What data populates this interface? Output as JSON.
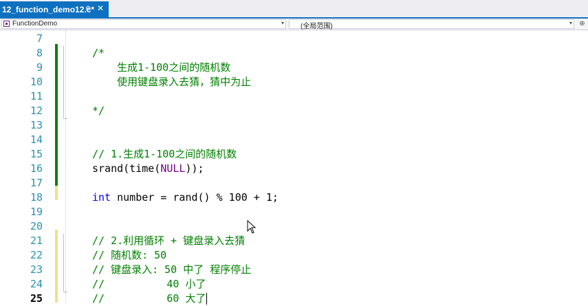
{
  "tab": {
    "title": "12_function_demo12.c*",
    "pin_glyph": "⊕",
    "close_glyph": "✕"
  },
  "nav": {
    "left_scope": "FunctionDemo",
    "right_scope": "(全局范围)",
    "dropdown_arrow": "▾",
    "split_glyph": "⊕"
  },
  "colors": {
    "accent": "#0e70c0",
    "comment": "#008000",
    "keyword": "#0000ff",
    "macro": "#6f008a",
    "line_number": "#2b91af",
    "change_saved": "#107c10",
    "change_unsaved": "#efe08a"
  },
  "lines": [
    {
      "no": "7",
      "tokens": []
    },
    {
      "no": "8",
      "tokens": [
        {
          "t": "/*",
          "k": "cm"
        }
      ]
    },
    {
      "no": "9",
      "tokens": [
        {
          "t": "    生成1-100之间的随机数",
          "k": "cm"
        }
      ]
    },
    {
      "no": "10",
      "tokens": [
        {
          "t": "    使用键盘录入去猜，猜中为止",
          "k": "cm"
        }
      ]
    },
    {
      "no": "11",
      "tokens": []
    },
    {
      "no": "12",
      "tokens": [
        {
          "t": "*/",
          "k": "cm"
        }
      ]
    },
    {
      "no": "13",
      "tokens": []
    },
    {
      "no": "14",
      "tokens": []
    },
    {
      "no": "15",
      "tokens": [
        {
          "t": "// 1.生成1-100之间的随机数",
          "k": "cm"
        }
      ]
    },
    {
      "no": "16",
      "tokens": [
        {
          "t": "srand(time(",
          "k": "pl"
        },
        {
          "t": "NULL",
          "k": "mac"
        },
        {
          "t": "));",
          "k": "pl"
        }
      ]
    },
    {
      "no": "17",
      "tokens": []
    },
    {
      "no": "18",
      "tokens": [
        {
          "t": "int",
          "k": "kw"
        },
        {
          "t": " number = rand() % 100 + 1;",
          "k": "pl"
        }
      ]
    },
    {
      "no": "19",
      "tokens": []
    },
    {
      "no": "20",
      "tokens": []
    },
    {
      "no": "21",
      "tokens": [
        {
          "t": "// 2.利用循环 + 键盘录入去猜",
          "k": "cm"
        }
      ]
    },
    {
      "no": "22",
      "tokens": [
        {
          "t": "// 随机数: 50",
          "k": "cm"
        }
      ]
    },
    {
      "no": "23",
      "tokens": [
        {
          "t": "// 键盘录入: 50 中了 程序停止",
          "k": "cm"
        }
      ]
    },
    {
      "no": "24",
      "tokens": [
        {
          "t": "//          40 小了",
          "k": "cm"
        }
      ]
    },
    {
      "no": "25",
      "tokens": [
        {
          "t": "//          60 大了",
          "k": "cm"
        }
      ]
    }
  ],
  "current_line": "25"
}
